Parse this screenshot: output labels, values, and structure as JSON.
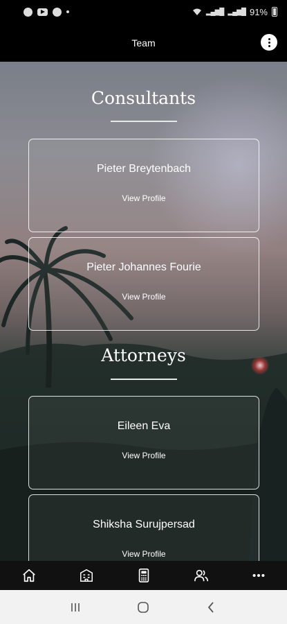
{
  "status_bar": {
    "battery": "91%",
    "icons": [
      "app-icon",
      "youtube-icon",
      "photos-icon",
      "dot-icon",
      "wifi-icon",
      "signal-icon",
      "signal-icon",
      "battery-icon"
    ]
  },
  "header": {
    "title": "Team",
    "menu_icon": "more-vertical-icon"
  },
  "sections": [
    {
      "title": "Consultants",
      "cards": [
        {
          "name": "Pieter Breytenbach",
          "action": "View Profile"
        },
        {
          "name": "Pieter Johannes Fourie",
          "action": "View Profile"
        }
      ]
    },
    {
      "title": "Attorneys",
      "cards": [
        {
          "name": "Eileen Eva",
          "action": "View Profile"
        },
        {
          "name": "Shiksha Surujpersad",
          "action": "View Profile"
        }
      ]
    }
  ],
  "bottom_nav": {
    "items": [
      "home-icon",
      "building-icon",
      "calculator-icon",
      "people-icon",
      "more-horizontal-icon"
    ]
  },
  "system_nav": {
    "items": [
      "recent-apps-icon",
      "home-circle-icon",
      "back-icon"
    ]
  },
  "colors": {
    "header_bg": "#000000",
    "nav_bg": "#111111",
    "system_nav_bg": "#f2f2f2"
  }
}
